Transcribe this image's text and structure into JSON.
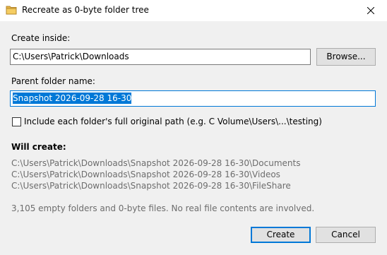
{
  "window": {
    "title": "Recreate as 0-byte folder tree"
  },
  "create_inside": {
    "label": "Create inside:",
    "value": "C:\\Users\\Patrick\\Downloads",
    "browse_label": "Browse..."
  },
  "parent_folder": {
    "label": "Parent folder name:",
    "value": "Snapshot 2026-09-28 16-30"
  },
  "include_path": {
    "label": "Include each folder's full original path (e.g. C Volume\\Users\\...\\testing)",
    "checked": false
  },
  "will_create": {
    "heading": "Will create:",
    "paths": [
      "C:\\Users\\Patrick\\Downloads\\Snapshot 2026-09-28 16-30\\Documents",
      "C:\\Users\\Patrick\\Downloads\\Snapshot 2026-09-28 16-30\\Videos",
      "C:\\Users\\Patrick\\Downloads\\Snapshot 2026-09-28 16-30\\FileShare"
    ],
    "summary": "3,105 empty folders and 0-byte files. No real file contents are involved."
  },
  "actions": {
    "create_label": "Create",
    "cancel_label": "Cancel"
  },
  "icons": {
    "title_icon": "folder-icon",
    "close_icon": "close-icon"
  },
  "colors": {
    "accent": "#0078d7",
    "background": "#f0f0f0",
    "muted_text": "#6d6d6d"
  }
}
